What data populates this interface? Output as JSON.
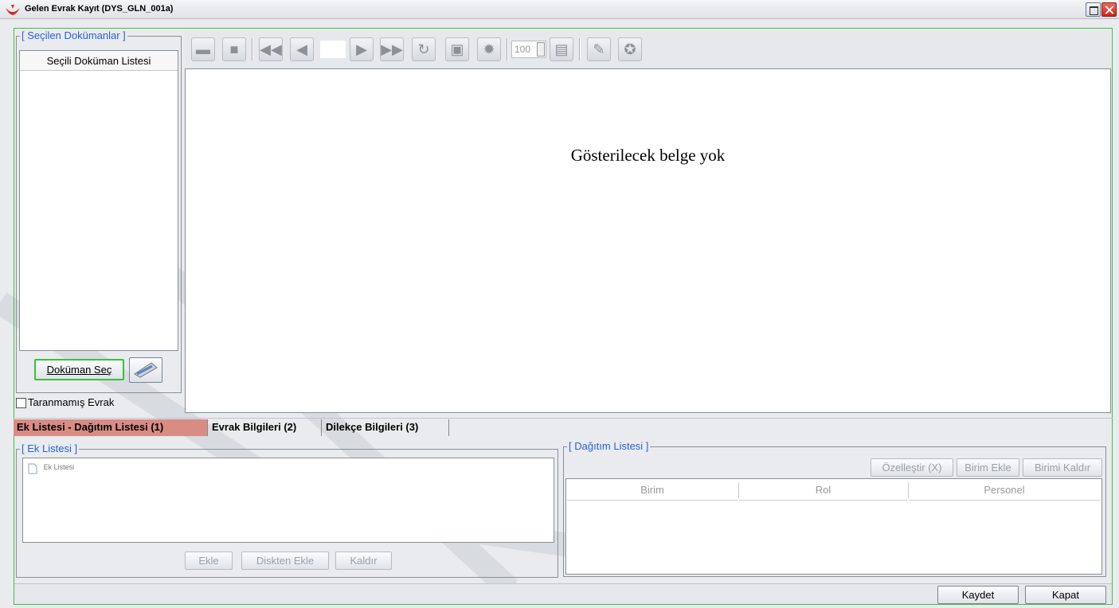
{
  "window": {
    "title": "Gelen Evrak Kayıt (DYS_GLN_001a)"
  },
  "selected_docs": {
    "group_title": "[ Seçilen Dokümanlar ]",
    "list_header": "Seçili Doküman Listesi",
    "select_button": "Doküman Seç",
    "unscanned_label": "Taranmamış Evrak"
  },
  "toolbar": {
    "zoom_value": "100"
  },
  "viewer": {
    "empty_message": "Gösterilecek belge yok"
  },
  "tabs": [
    {
      "label": "Ek Listesi - Dağıtım Listesi (1)"
    },
    {
      "label": "Evrak Bilgileri (2)"
    },
    {
      "label": "Dilekçe Bilgileri (3)"
    }
  ],
  "attachments": {
    "group_title": "[ Ek Listesi ]",
    "tree_root": "Ek Listesi",
    "add_button": "Ekle",
    "add_from_disk_button": "Diskten Ekle",
    "remove_button": "Kaldır"
  },
  "distribution": {
    "group_title": "[ Dağıtım Listesi ]",
    "customize_button": "Özelleştir (X)",
    "add_unit_button": "Birim Ekle",
    "remove_unit_button": "Birimi Kaldır",
    "columns": [
      "Birim",
      "Rol",
      "Personel"
    ]
  },
  "footer": {
    "save_button": "Kaydet",
    "close_button": "Kapat"
  }
}
